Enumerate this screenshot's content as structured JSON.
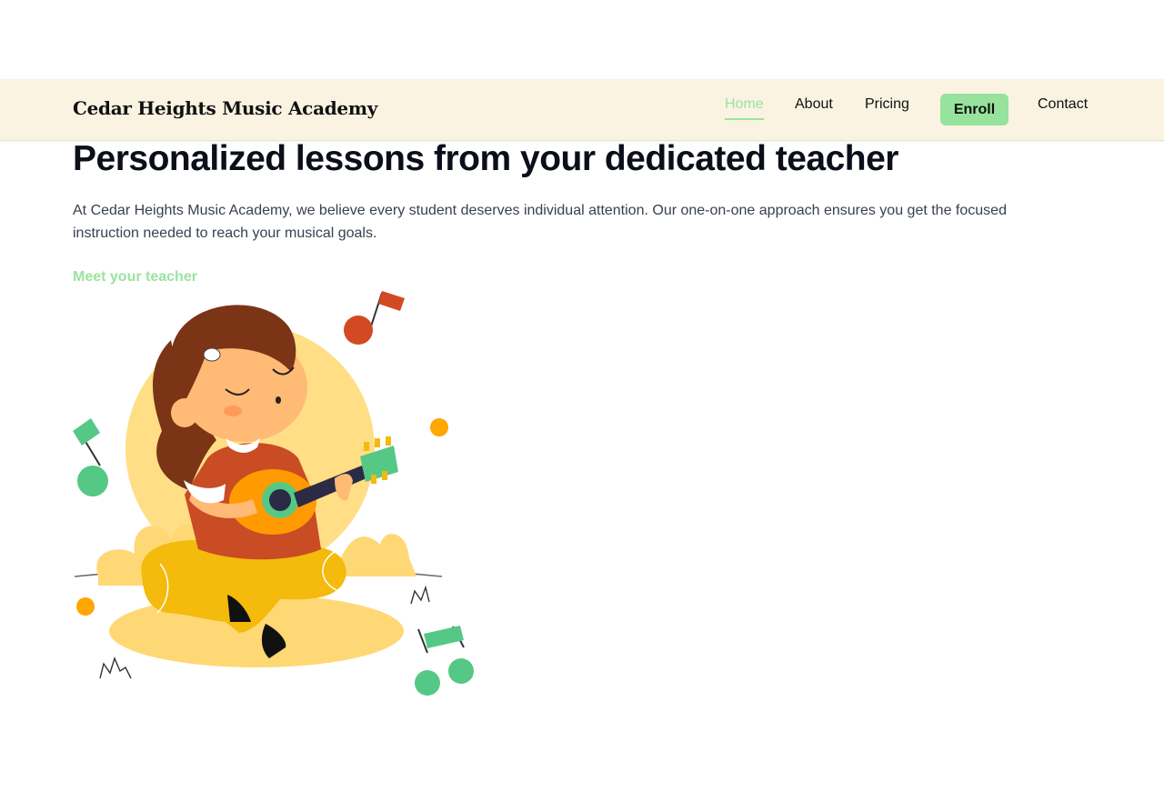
{
  "brand": {
    "name": "Cedar Heights Music Academy"
  },
  "nav": {
    "items": [
      {
        "label": "Home",
        "active": true
      },
      {
        "label": "About",
        "active": false
      },
      {
        "label": "Pricing",
        "active": false
      },
      {
        "label": "Enroll",
        "active": false,
        "style": "button"
      },
      {
        "label": "Contact",
        "active": false
      }
    ]
  },
  "hero": {
    "title": "Personalized lessons from your dedicated teacher",
    "description": "At Cedar Heights Music Academy, we believe every student deserves individual attention. Our one-on-one approach ensures you get the focused instruction needed to reach your musical goals.",
    "cta_label": "Meet your teacher"
  },
  "illustration": {
    "icon": "girl-playing-ukulele-illustration"
  },
  "colors": {
    "nav_background": "#faf3e2",
    "accent_green": "#97e39d",
    "text_dark": "#0b0f19",
    "body_text": "#374151"
  }
}
